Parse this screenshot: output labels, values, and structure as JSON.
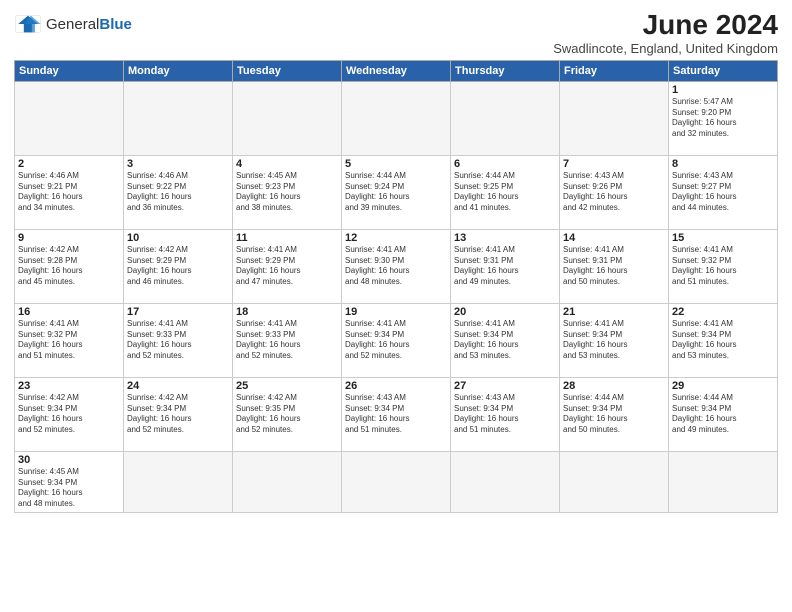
{
  "logo": {
    "text_general": "General",
    "text_blue": "Blue"
  },
  "title": {
    "month_year": "June 2024",
    "location": "Swadlincote, England, United Kingdom"
  },
  "weekdays": [
    "Sunday",
    "Monday",
    "Tuesday",
    "Wednesday",
    "Thursday",
    "Friday",
    "Saturday"
  ],
  "weeks": [
    [
      {
        "day": "",
        "empty": true
      },
      {
        "day": "",
        "empty": true
      },
      {
        "day": "",
        "empty": true
      },
      {
        "day": "",
        "empty": true
      },
      {
        "day": "",
        "empty": true
      },
      {
        "day": "",
        "empty": true
      },
      {
        "day": "1",
        "sunrise": "5:47 AM",
        "sunset": "9:20 PM",
        "daylight": "16 hours and 32 minutes."
      }
    ],
    [
      {
        "day": "2",
        "sunrise": "4:46 AM",
        "sunset": "9:21 PM",
        "daylight": "16 hours and 34 minutes."
      },
      {
        "day": "3",
        "sunrise": "4:46 AM",
        "sunset": "9:22 PM",
        "daylight": "16 hours and 36 minutes."
      },
      {
        "day": "4",
        "sunrise": "4:45 AM",
        "sunset": "9:23 PM",
        "daylight": "16 hours and 38 minutes."
      },
      {
        "day": "5",
        "sunrise": "4:44 AM",
        "sunset": "9:24 PM",
        "daylight": "16 hours and 39 minutes."
      },
      {
        "day": "6",
        "sunrise": "4:44 AM",
        "sunset": "9:25 PM",
        "daylight": "16 hours and 41 minutes."
      },
      {
        "day": "7",
        "sunrise": "4:43 AM",
        "sunset": "9:26 PM",
        "daylight": "16 hours and 42 minutes."
      },
      {
        "day": "8",
        "sunrise": "4:43 AM",
        "sunset": "9:27 PM",
        "daylight": "16 hours and 44 minutes."
      }
    ],
    [
      {
        "day": "9",
        "sunrise": "4:42 AM",
        "sunset": "9:28 PM",
        "daylight": "16 hours and 45 minutes."
      },
      {
        "day": "10",
        "sunrise": "4:42 AM",
        "sunset": "9:29 PM",
        "daylight": "16 hours and 46 minutes."
      },
      {
        "day": "11",
        "sunrise": "4:41 AM",
        "sunset": "9:29 PM",
        "daylight": "16 hours and 47 minutes."
      },
      {
        "day": "12",
        "sunrise": "4:41 AM",
        "sunset": "9:30 PM",
        "daylight": "16 hours and 48 minutes."
      },
      {
        "day": "13",
        "sunrise": "4:41 AM",
        "sunset": "9:31 PM",
        "daylight": "16 hours and 49 minutes."
      },
      {
        "day": "14",
        "sunrise": "4:41 AM",
        "sunset": "9:31 PM",
        "daylight": "16 hours and 50 minutes."
      },
      {
        "day": "15",
        "sunrise": "4:41 AM",
        "sunset": "9:32 PM",
        "daylight": "16 hours and 51 minutes."
      }
    ],
    [
      {
        "day": "16",
        "sunrise": "4:41 AM",
        "sunset": "9:32 PM",
        "daylight": "16 hours and 51 minutes."
      },
      {
        "day": "17",
        "sunrise": "4:41 AM",
        "sunset": "9:33 PM",
        "daylight": "16 hours and 52 minutes."
      },
      {
        "day": "18",
        "sunrise": "4:41 AM",
        "sunset": "9:33 PM",
        "daylight": "16 hours and 52 minutes."
      },
      {
        "day": "19",
        "sunrise": "4:41 AM",
        "sunset": "9:34 PM",
        "daylight": "16 hours and 52 minutes."
      },
      {
        "day": "20",
        "sunrise": "4:41 AM",
        "sunset": "9:34 PM",
        "daylight": "16 hours and 53 minutes."
      },
      {
        "day": "21",
        "sunrise": "4:41 AM",
        "sunset": "9:34 PM",
        "daylight": "16 hours and 53 minutes."
      },
      {
        "day": "22",
        "sunrise": "4:41 AM",
        "sunset": "9:34 PM",
        "daylight": "16 hours and 53 minutes."
      }
    ],
    [
      {
        "day": "23",
        "sunrise": "4:42 AM",
        "sunset": "9:34 PM",
        "daylight": "16 hours and 52 minutes."
      },
      {
        "day": "24",
        "sunrise": "4:42 AM",
        "sunset": "9:34 PM",
        "daylight": "16 hours and 52 minutes."
      },
      {
        "day": "25",
        "sunrise": "4:42 AM",
        "sunset": "9:35 PM",
        "daylight": "16 hours and 52 minutes."
      },
      {
        "day": "26",
        "sunrise": "4:43 AM",
        "sunset": "9:34 PM",
        "daylight": "16 hours and 51 minutes."
      },
      {
        "day": "27",
        "sunrise": "4:43 AM",
        "sunset": "9:34 PM",
        "daylight": "16 hours and 51 minutes."
      },
      {
        "day": "28",
        "sunrise": "4:44 AM",
        "sunset": "9:34 PM",
        "daylight": "16 hours and 50 minutes."
      },
      {
        "day": "29",
        "sunrise": "4:44 AM",
        "sunset": "9:34 PM",
        "daylight": "16 hours and 49 minutes."
      }
    ],
    [
      {
        "day": "30",
        "sunrise": "4:45 AM",
        "sunset": "9:34 PM",
        "daylight": "16 hours and 48 minutes."
      },
      {
        "day": "",
        "empty": true
      },
      {
        "day": "",
        "empty": true
      },
      {
        "day": "",
        "empty": true
      },
      {
        "day": "",
        "empty": true
      },
      {
        "day": "",
        "empty": true
      },
      {
        "day": "",
        "empty": true
      }
    ]
  ]
}
